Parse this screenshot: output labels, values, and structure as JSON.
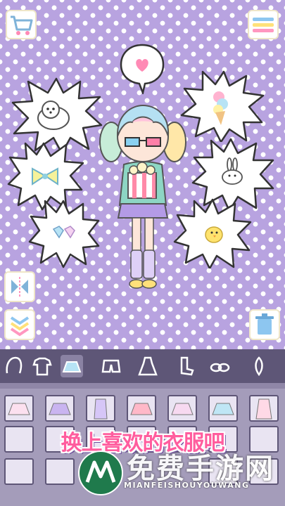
{
  "top_bar": {
    "shop_icon": "cart-icon",
    "menu_icon": "menu-icon"
  },
  "speech": {
    "icon": "heart-icon"
  },
  "bubbles": [
    {
      "name": "dog-bubble",
      "icon": "dog-icon"
    },
    {
      "name": "bow-bubble",
      "icon": "bow-icon"
    },
    {
      "name": "gem-bubble",
      "icon": "gem-icon"
    },
    {
      "name": "icecream-bubble",
      "icon": "icecream-icon"
    },
    {
      "name": "bunny-bubble",
      "icon": "bunny-icon"
    },
    {
      "name": "chick-bubble",
      "icon": "chick-icon"
    }
  ],
  "side_buttons": {
    "flip": "flip-icon",
    "layers": "layers-icon",
    "trash": "trash-icon"
  },
  "tabs": [
    "hair",
    "shirt",
    "skirt",
    "shorts",
    "dress",
    "socks",
    "shoes",
    "accessory"
  ],
  "selected_tab": "skirt",
  "promo_text": "换上喜欢的衣服吧",
  "watermark": {
    "title": "免费手游网",
    "subtitle": "MIANFEISHOUYOUWANG"
  },
  "colors": {
    "background": "#b8a3e0",
    "panel": "#5e5677",
    "promo": "#ff5d9e"
  }
}
